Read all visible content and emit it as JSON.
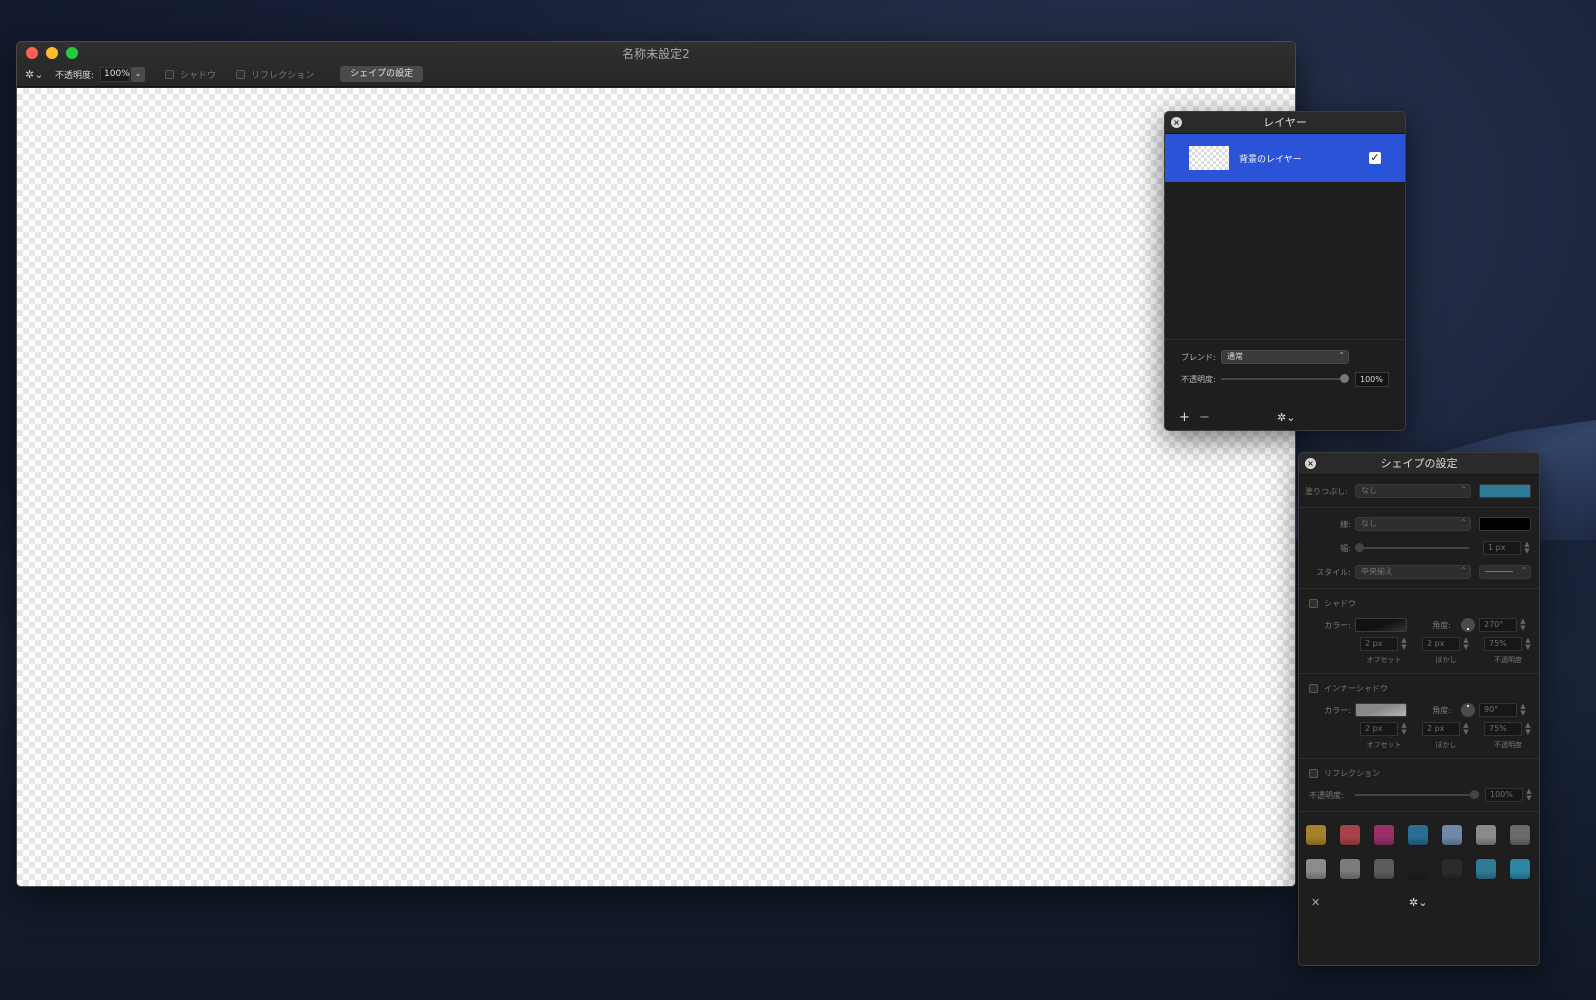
{
  "window": {
    "title": "名称未設定2"
  },
  "toolbar": {
    "gear": "✲⌄",
    "opacity_label": "不透明度:",
    "opacity_value": "100%",
    "dropdown_glyph": "⌄",
    "shadow_label": "シャドウ",
    "reflection_label": "リフレクション",
    "shape_settings_button": "シェイプの設定"
  },
  "layers_panel": {
    "title": "レイヤー",
    "close_glyph": "×",
    "layers": [
      {
        "name": "背景のレイヤー",
        "visible": true,
        "check_glyph": "✓"
      }
    ],
    "blend_label": "ブレンド:",
    "blend_value": "通常",
    "opacity_label": "不透明度:",
    "opacity_value": "100%",
    "opacity_level": 1.0,
    "add_glyph": "+",
    "remove_glyph": "−",
    "gear_glyph": "✲⌄"
  },
  "shape_panel": {
    "title": "シェイプの設定",
    "close_glyph": "×",
    "fill_label": "塗りつぶし:",
    "fill_value": "なし",
    "fill_color": "#2e7b96",
    "stroke_label": "線:",
    "stroke_value": "なし",
    "stroke_color": "#000000",
    "width_label": "幅:",
    "width_value": "1 px",
    "style_label": "スタイル:",
    "style_value": "中央揃え",
    "shadow": {
      "label": "シャドウ",
      "color_label": "カラー:",
      "angle_label": "角度:",
      "angle_value": "270°",
      "offset_value": "2 px",
      "blur_value": "2 px",
      "opacity_value": "75%",
      "offset_caption": "オフセット",
      "blur_caption": "ぼかし",
      "opacity_caption": "不透明度"
    },
    "inner_shadow": {
      "label": "インナーシャドウ",
      "color_label": "カラー:",
      "angle_label": "角度:",
      "angle_value": "90°",
      "offset_value": "2 px",
      "blur_value": "2 px",
      "opacity_value": "75%",
      "offset_caption": "オフセット",
      "blur_caption": "ぼかし",
      "opacity_caption": "不透明度"
    },
    "reflection": {
      "label": "リフレクション",
      "opacity_label": "不透明度:",
      "opacity_value": "100%"
    },
    "preset_colors": [
      "#a5832a",
      "#a8424a",
      "#9a2f6a",
      "#2a6d92",
      "#6f89a8",
      "#8a8a8a",
      "#6a6a6a",
      "#8c8c8c",
      "#7c7c7c",
      "#5c5c5c",
      "#1e1e1e",
      "#2b2b2b",
      "#2e7b96",
      "#2e86a4"
    ],
    "footer_close_glyph": "✕",
    "gear_glyph": "✲⌄"
  }
}
